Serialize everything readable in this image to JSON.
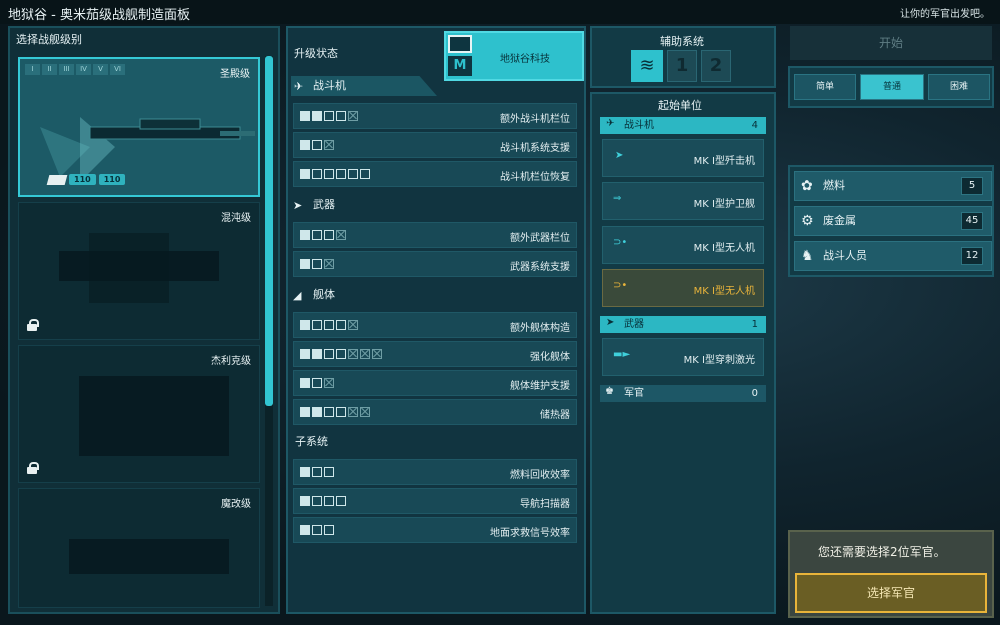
{
  "window": {
    "title": "地狱谷 - 奥米茄级战舰制造面板",
    "hint": "让你的军官出发吧。"
  },
  "left": {
    "heading": "选择战舰级别",
    "ships": [
      {
        "name": "圣殿级",
        "locked": false,
        "stats": [
          "110",
          "110"
        ]
      },
      {
        "name": "混沌级",
        "locked": true
      },
      {
        "name": "杰利克级",
        "locked": true
      },
      {
        "name": "魔改级",
        "locked": false
      }
    ],
    "tiers": [
      "I",
      "II",
      "III",
      "IV",
      "V",
      "VI"
    ]
  },
  "upgrades": {
    "heading": "升级状态",
    "tech_label": "地狱谷科技",
    "sections": [
      {
        "name": "战斗机",
        "rows": [
          {
            "label": "额外战斗机栏位",
            "boxes": "ffeex"
          },
          {
            "label": "战斗机系统支援",
            "boxes": "fex"
          },
          {
            "label": "战斗机栏位恢复",
            "boxes": "feeeee"
          }
        ]
      },
      {
        "name": "武器",
        "rows": [
          {
            "label": "额外武器栏位",
            "boxes": "feex"
          },
          {
            "label": "武器系统支援",
            "boxes": "fex"
          }
        ]
      },
      {
        "name": "舰体",
        "rows": [
          {
            "label": "额外舰体构造",
            "boxes": "feeex"
          },
          {
            "label": "强化舰体",
            "boxes": "ffeexxx"
          },
          {
            "label": "舰体维护支援",
            "boxes": "fex"
          },
          {
            "label": "储热器",
            "boxes": "ffeexx"
          }
        ]
      },
      {
        "name": "子系统",
        "rows": [
          {
            "label": "燃料回收效率",
            "boxes": "fee"
          },
          {
            "label": "导航扫描器",
            "boxes": "feee"
          },
          {
            "label": "地面求救信号效率",
            "boxes": "fee"
          }
        ]
      }
    ]
  },
  "aux": {
    "heading": "辅助系统",
    "slots": [
      "1",
      "2"
    ]
  },
  "start_units": {
    "heading": "起始单位",
    "fighters": {
      "label": "战斗机",
      "count": "4",
      "units": [
        "MK I型歼击机",
        "MK I型护卫舰",
        "MK I型无人机",
        "MK I型无人机"
      ]
    },
    "weapons": {
      "label": "武器",
      "count": "1",
      "units": [
        "MK I型穿刺激光"
      ]
    },
    "officers": {
      "label": "军官",
      "count": "0"
    }
  },
  "right": {
    "start_label": "开始",
    "difficulty": [
      "简单",
      "普通",
      "困难"
    ],
    "selected_difficulty": "普通",
    "resources": [
      {
        "label": "燃料",
        "value": "5"
      },
      {
        "label": "废金属",
        "value": "45"
      },
      {
        "label": "战斗人员",
        "value": "12"
      }
    ],
    "officer_note": "您还需要选择2位军官。",
    "officer_button": "选择军官"
  },
  "colors": {
    "accent": "#35c9d6",
    "highlight": "#e9b43a"
  }
}
